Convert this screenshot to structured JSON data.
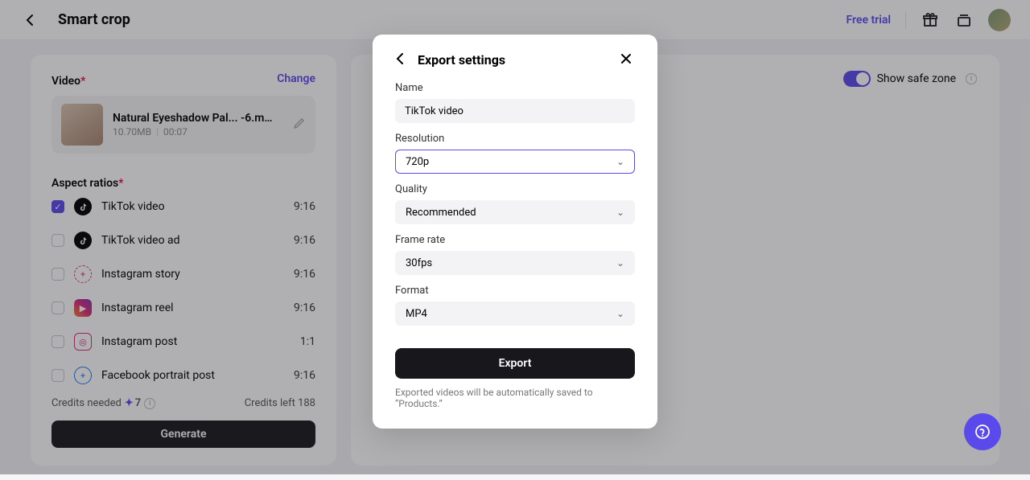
{
  "topbar": {
    "title": "Smart crop",
    "free_trial": "Free trial"
  },
  "left": {
    "video_label": "Video",
    "change_label": "Change",
    "video": {
      "name": "Natural Eyeshadow Pal... -6.mp4",
      "size": "10.70MB",
      "duration": "00:07"
    },
    "aspect_label": "Aspect ratios",
    "ratios": [
      {
        "name": "TikTok video",
        "ratio": "9:16",
        "checked": true,
        "icon": "tiktok"
      },
      {
        "name": "TikTok video ad",
        "ratio": "9:16",
        "checked": false,
        "icon": "tiktok"
      },
      {
        "name": "Instagram story",
        "ratio": "9:16",
        "checked": false,
        "icon": "ig-story"
      },
      {
        "name": "Instagram reel",
        "ratio": "9:16",
        "checked": false,
        "icon": "ig-reel"
      },
      {
        "name": "Instagram post",
        "ratio": "1:1",
        "checked": false,
        "icon": "ig-post"
      },
      {
        "name": "Facebook portrait post",
        "ratio": "9:16",
        "checked": false,
        "icon": "fb"
      }
    ],
    "credits_needed_label": "Credits needed",
    "credits_needed": "7",
    "credits_left_label": "Credits left 188",
    "generate_label": "Generate"
  },
  "right": {
    "safe_zone_label": "Show safe zone"
  },
  "modal": {
    "title": "Export settings",
    "name_label": "Name",
    "name_value": "TikTok video",
    "resolution_label": "Resolution",
    "resolution_value": "720p",
    "quality_label": "Quality",
    "quality_value": "Recommended",
    "framerate_label": "Frame rate",
    "framerate_value": "30fps",
    "format_label": "Format",
    "format_value": "MP4",
    "export_label": "Export",
    "note": "Exported videos will be automatically saved to “Products.”"
  }
}
